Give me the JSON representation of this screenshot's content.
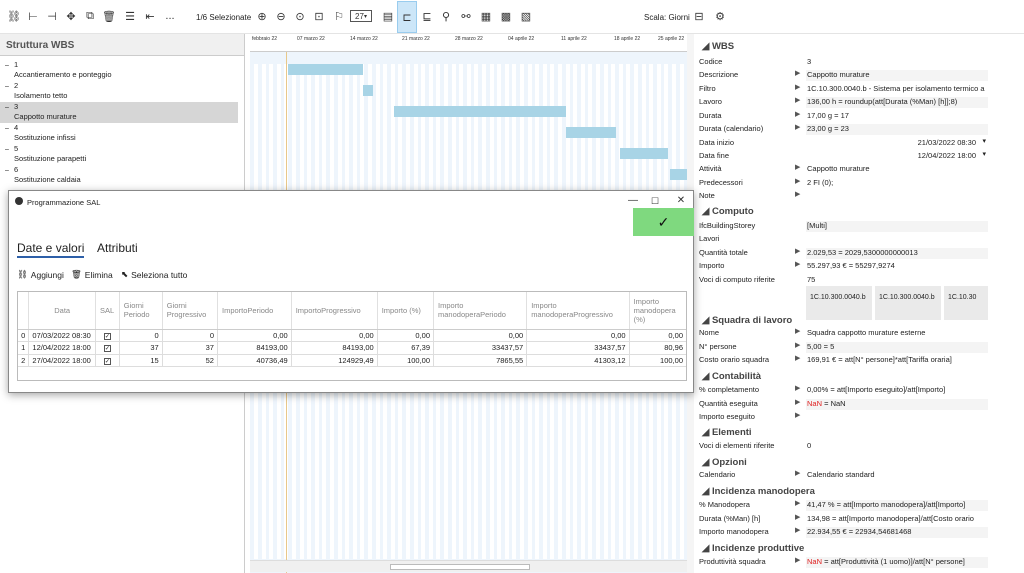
{
  "toolbar": {
    "selection_count": "1/6 Selezionate",
    "scale_label": "Scala: Giorni",
    "more_label": "...",
    "zoom_day": "27"
  },
  "wbs_panel": {
    "title": "Struttura WBS",
    "items": [
      {
        "num": "1",
        "label": "Accantieramento e ponteggio"
      },
      {
        "num": "2",
        "label": "Isolamento tetto"
      },
      {
        "num": "3",
        "label": "Cappotto murature"
      },
      {
        "num": "4",
        "label": "Sostituzione infissi"
      },
      {
        "num": "5",
        "label": "Sostituzione parapetti"
      },
      {
        "num": "6",
        "label": "Sostituzione caldaia"
      }
    ]
  },
  "gantt": {
    "dates": [
      "febbraio 22",
      "07 marzo 22",
      "14 marzo 22",
      "21 marzo 22",
      "28 marzo 22",
      "04 aprile 22",
      "11 aprile 22",
      "18 aprile 22",
      "25 aprile 22"
    ]
  },
  "dialog": {
    "title": "Programmazione SAL",
    "ok_icon": "✓",
    "tabs": [
      "Date e valori",
      "Attributi"
    ],
    "actions": {
      "add": "Aggiungi",
      "delete": "Elimina",
      "select_all": "Seleziona tutto"
    },
    "columns": [
      "Data",
      "SAL",
      "Giorni Periodo",
      "Giorni Progressivo",
      "ImportoPeriodo",
      "ImportoProgressivo",
      "Importo (%)",
      "Importo manodoperaPeriodo",
      "Importo manodoperaProgressivo",
      "Importo manodopera (%)"
    ],
    "rows": [
      {
        "idx": "0",
        "data": "07/03/2022 08:30",
        "sal": true,
        "gp": "0",
        "gpr": "0",
        "ip": "0,00",
        "ipr": "0,00",
        "ipc": "0,00",
        "mp": "0,00",
        "mpr": "0,00",
        "mpc": "0,00"
      },
      {
        "idx": "1",
        "data": "12/04/2022 18:00",
        "sal": true,
        "gp": "37",
        "gpr": "37",
        "ip": "84193,00",
        "ipr": "84193,00",
        "ipc": "67,39",
        "mp": "33437,57",
        "mpr": "33437,57",
        "mpc": "80,96"
      },
      {
        "idx": "2",
        "data": "27/04/2022 18:00",
        "sal": true,
        "gp": "15",
        "gpr": "52",
        "ip": "40736,49",
        "ipr": "124929,49",
        "ipc": "100,00",
        "mp": "7865,55",
        "mpr": "41303,12",
        "mpc": "100,00"
      }
    ]
  },
  "props": {
    "wbs_title": "WBS",
    "codice": {
      "k": "Codice",
      "v": "3"
    },
    "descrizione": {
      "k": "Descrizione",
      "v": "Cappotto murature"
    },
    "filtro": {
      "k": "Filtro",
      "v": "1C.10.300.0040.b - Sistema per isolamento termico a"
    },
    "lavoro": {
      "k": "Lavoro",
      "v": "136,00 h = roundup(att[Durata (%Man) [h]];8)"
    },
    "durata": {
      "k": "Durata",
      "v": "17,00 g = 17"
    },
    "durata_cal": {
      "k": "Durata (calendario)",
      "v": "23,00 g = 23"
    },
    "data_inizio": {
      "k": "Data inizio",
      "v": "21/03/2022 08:30"
    },
    "data_fine": {
      "k": "Data fine",
      "v": "12/04/2022 18:00"
    },
    "attivita": {
      "k": "Attività",
      "v": "Cappotto murature"
    },
    "predecessori": {
      "k": "Predecessori",
      "v": "2 FI (0);"
    },
    "note": {
      "k": "Note",
      "v": ""
    },
    "computo_title": "Computo",
    "ifc": {
      "k": "IfcBuildingStorey",
      "v": "[Multi]"
    },
    "lavori": {
      "k": "Lavori",
      "v": ""
    },
    "quantita": {
      "k": "Quantità totale",
      "v": "2.029,53 = 2029,5300000000013"
    },
    "importo": {
      "k": "Importo",
      "v": "55.297,93 € = 55297,9274"
    },
    "voci": {
      "k": "Voci di computo riferite",
      "v": "75",
      "chips": [
        "1C.10.300.0040.b",
        "1C.10.300.0040.b",
        "1C.10.30"
      ]
    },
    "squadra_title": "Squadra di lavoro",
    "nome": {
      "k": "Nome",
      "v": "Squadra cappotto murature esterne"
    },
    "persone": {
      "k": "N° persone",
      "v": "5,00 = 5"
    },
    "costo": {
      "k": "Costo orario squadra",
      "v": "169,91 € = att[N° persone]*att[Tariffa oraria]"
    },
    "contab_title": "Contabilità",
    "compl": {
      "k": "% completamento",
      "v": "0,00% = att[Importo eseguito]/att[Importo]"
    },
    "qta_eseg": {
      "k": "Quantità eseguita",
      "v1": "NaN",
      "v2": "= NaN"
    },
    "imp_eseg": {
      "k": "Importo eseguito",
      "v": ""
    },
    "elem_title": "Elementi",
    "voci_elem": {
      "k": "Voci di elementi riferite",
      "v": "0"
    },
    "opz_title": "Opzioni",
    "calendario": {
      "k": "Calendario",
      "v": "Calendario standard"
    },
    "inc_title": "Incidenza manodopera",
    "perc_mano": {
      "k": "% Manodopera",
      "v": "41,47 % = att[Importo manodopera]/att[Importo]"
    },
    "dur_man": {
      "k": "Durata (%Man) [h]",
      "v": "134,98 = att[Importo manodopera]/att[Costo orario"
    },
    "imp_mano": {
      "k": "Importo manodopera",
      "v": "22.934,55 € = 22934,54681468"
    },
    "prod_title": "Incidenze produttive",
    "prod": {
      "k": "Produttività squadra",
      "v1": "NaN",
      "v2": "= att[Produttività (1 uomo)]/att[N° persone]"
    }
  }
}
